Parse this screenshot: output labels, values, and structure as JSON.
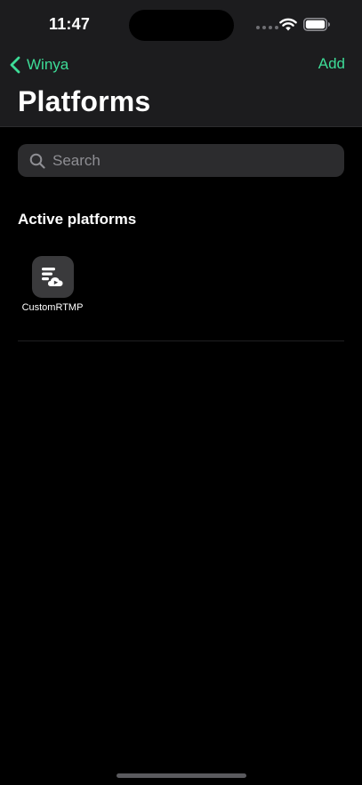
{
  "status_bar": {
    "time": "11:47"
  },
  "nav": {
    "back_label": "Winya",
    "add_label": "Add",
    "title": "Platforms"
  },
  "search": {
    "placeholder": "Search",
    "value": ""
  },
  "section": {
    "title": "Active platforms",
    "platforms": [
      {
        "label": "CustomRTMP",
        "icon": "server-cloud-icon"
      }
    ]
  },
  "colors": {
    "accent": "#3ddc97",
    "background": "#000000",
    "header": "#1c1c1e",
    "search_bg": "#2c2c2e",
    "tile_bg": "#3a3a3c"
  }
}
